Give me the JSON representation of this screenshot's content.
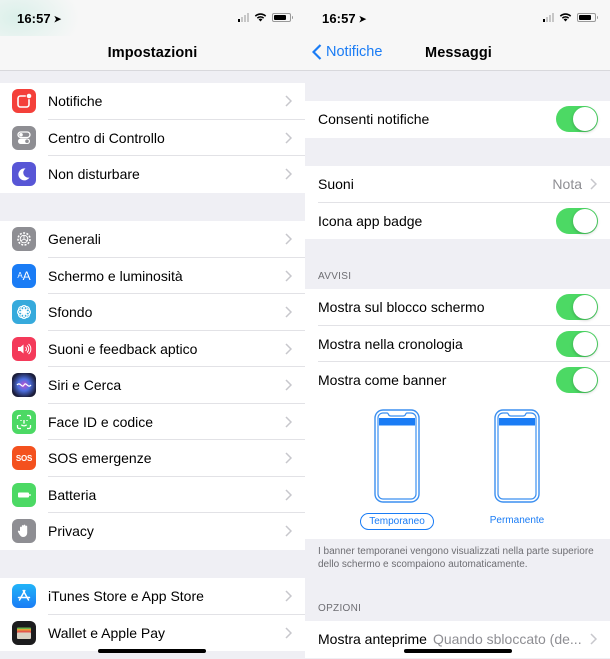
{
  "left": {
    "status": {
      "time": "16:57"
    },
    "nav": {
      "title": "Impostazioni"
    },
    "groups": [
      [
        {
          "label": "Notifiche",
          "icon": "notifications-icon",
          "color": "#f4403a"
        },
        {
          "label": "Centro di Controllo",
          "icon": "control-center-icon",
          "color": "#8e8e93"
        },
        {
          "label": "Non disturbare",
          "icon": "moon-icon",
          "color": "#5856d6"
        }
      ],
      [
        {
          "label": "Generali",
          "icon": "gear-icon",
          "color": "#8e8e93"
        },
        {
          "label": "Schermo e luminosità",
          "icon": "display-text-size-icon",
          "color": "#1a7cf5",
          "glyph": "AA"
        },
        {
          "label": "Sfondo",
          "icon": "wallpaper-flower-icon",
          "color": "#36aadc"
        },
        {
          "label": "Suoni e feedback aptico",
          "icon": "speaker-icon",
          "color": "#f43a5a"
        },
        {
          "label": "Siri e Cerca",
          "icon": "siri-icon",
          "color": "#2b2f6b"
        },
        {
          "label": "Face ID e codice",
          "icon": "face-id-icon",
          "color": "#4cd964"
        },
        {
          "label": "SOS emergenze",
          "icon": "sos-icon",
          "color": "#f4511e",
          "glyph": "SOS"
        },
        {
          "label": "Batteria",
          "icon": "battery-icon",
          "color": "#4cd964"
        },
        {
          "label": "Privacy",
          "icon": "hand-icon",
          "color": "#8e8e93"
        }
      ],
      [
        {
          "label": "iTunes Store e App Store",
          "icon": "app-store-icon",
          "color": "#1a8ef5"
        },
        {
          "label": "Wallet e Apple Pay",
          "icon": "wallet-icon",
          "color": "#1c1c1e"
        }
      ]
    ]
  },
  "right": {
    "status": {
      "time": "16:57"
    },
    "nav": {
      "back_label": "Notifiche",
      "title": "Messaggi"
    },
    "allow": {
      "label": "Consenti notifiche",
      "on": true
    },
    "sounds": {
      "label": "Suoni",
      "value": "Nota"
    },
    "badge": {
      "label": "Icona app badge",
      "on": true
    },
    "alerts": {
      "header": "AVVISI",
      "items": [
        {
          "label": "Mostra sul blocco schermo",
          "on": true
        },
        {
          "label": "Mostra nella cronologia",
          "on": true
        },
        {
          "label": "Mostra come banner",
          "on": true
        }
      ]
    },
    "banner_styles": [
      {
        "label": "Temporaneo",
        "selected": true
      },
      {
        "label": "Permanente",
        "selected": false
      }
    ],
    "banner_note": "I banner temporanei vengono visualizzati nella parte superiore dello schermo e scompaiono automaticamente.",
    "options": {
      "header": "OPZIONI",
      "preview": {
        "label": "Mostra anteprime",
        "value": "Quando sbloccato (de..."
      }
    }
  },
  "colors": {
    "accent": "#1a7cf5",
    "toggle_on": "#4cd964",
    "background": "#efeff4"
  }
}
